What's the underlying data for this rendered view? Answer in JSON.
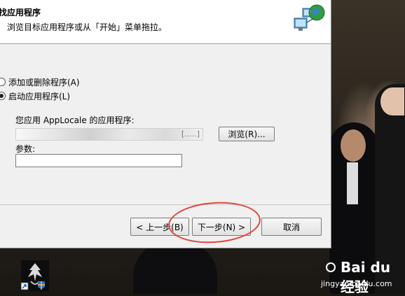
{
  "wizard": {
    "title": "找应用程序",
    "subtitle": "浏览目标应用程序或从「开始」菜单拖拉。",
    "options": [
      {
        "label": "添加或删除程序(A)",
        "checked": false
      },
      {
        "label": "启动应用程序(L)",
        "checked": true
      }
    ],
    "app_label": "您应用 AppLocale 的应用程序:",
    "app_path_tail": "[.....]",
    "browse_label": "浏览(R)...",
    "params_label": "参数:",
    "params_value": "",
    "back_label": "< 上一步(B)",
    "next_label": "下一步(N) >",
    "cancel_label": "取消"
  },
  "watermark": {
    "brand": "Bai du 经验",
    "url": "jingyan.baidu.com"
  },
  "colors": {
    "annotation_circle": "#e0463c"
  }
}
